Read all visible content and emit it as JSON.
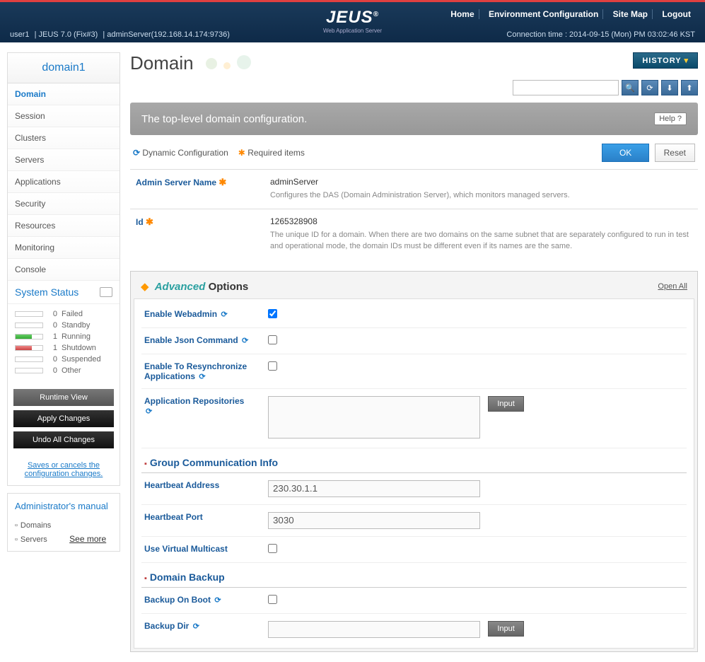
{
  "header": {
    "brand": "JEUS",
    "brand_sub": "Web Application Server",
    "nav": {
      "home": "Home",
      "env": "Environment Configuration",
      "sitemap": "Site Map",
      "logout": "Logout"
    },
    "user": "user1",
    "version": "JEUS 7.0 (Fix#3)",
    "server": "adminServer(192.168.14.174:9736)",
    "conn_time": "Connection time : 2014-09-15 (Mon) PM 03:02:46 KST"
  },
  "sidebar": {
    "domain_name": "domain1",
    "nav": [
      "Domain",
      "Session",
      "Clusters",
      "Servers",
      "Applications",
      "Security",
      "Resources",
      "Monitoring",
      "Console"
    ],
    "system_status_title": "System Status",
    "statuses": [
      {
        "count": "0",
        "label": "Failed",
        "cls": ""
      },
      {
        "count": "0",
        "label": "Standby",
        "cls": ""
      },
      {
        "count": "1",
        "label": "Running",
        "cls": "green"
      },
      {
        "count": "1",
        "label": "Shutdown",
        "cls": "red"
      },
      {
        "count": "0",
        "label": "Suspended",
        "cls": ""
      },
      {
        "count": "0",
        "label": "Other",
        "cls": ""
      }
    ],
    "buttons": {
      "runtime": "Runtime View",
      "apply": "Apply Changes",
      "undo": "Undo All Changes"
    },
    "save_note": "Saves or cancels the configuration changes.",
    "manual_title": "Administrator's manual",
    "manual_items": [
      "Domains",
      "Servers"
    ],
    "see_more": "See more"
  },
  "page": {
    "title": "Domain",
    "history": "HISTORY",
    "desc": "The top-level domain configuration.",
    "help": "Help",
    "legend": {
      "dyn": "Dynamic Configuration",
      "req": "Required items"
    },
    "ok": "OK",
    "reset": "Reset"
  },
  "config": {
    "admin_server_name_label": "Admin Server Name",
    "admin_server_name_value": "adminServer",
    "admin_server_name_desc": "Configures the DAS (Domain Administration Server), which monitors managed servers.",
    "id_label": "Id",
    "id_value": "1265328908",
    "id_desc": "The unique ID for a domain. When there are two domains on the same subnet that are separately configured to run in test and operational mode, the domain IDs must be different even if its names are the same."
  },
  "adv": {
    "advanced": "Advanced",
    "options": "Options",
    "open_all": "Open All",
    "enable_webadmin": "Enable Webadmin",
    "enable_json": "Enable Json Command",
    "enable_resync": "Enable To Resynchronize Applications",
    "app_repos": "Application Repositories",
    "input_btn": "Input",
    "group_comm": "Group Communication Info",
    "heartbeat_addr_label": "Heartbeat Address",
    "heartbeat_addr_value": "230.30.1.1",
    "heartbeat_port_label": "Heartbeat Port",
    "heartbeat_port_value": "3030",
    "use_virtual_multicast": "Use Virtual Multicast",
    "domain_backup": "Domain Backup",
    "backup_on_boot": "Backup On Boot",
    "backup_dir": "Backup Dir"
  }
}
